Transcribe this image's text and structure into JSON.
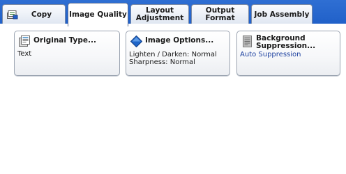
{
  "tabs": [
    {
      "label": "Copy",
      "icon": "copy-icon"
    },
    {
      "label": "Image Quality"
    },
    {
      "label_line1": "Layout",
      "label_line2": "Adjustment"
    },
    {
      "label": "Output Format"
    },
    {
      "label": "Job Assembly"
    }
  ],
  "features": {
    "original_type": {
      "title": "Original Type...",
      "value": "Text",
      "icon": "original-type-icon"
    },
    "image_options": {
      "title": "Image Options...",
      "value_line1": "Lighten / Darken: Normal",
      "value_line2": "Sharpness: Normal",
      "icon": "diamond-icon"
    },
    "background_suppression": {
      "title_line1": "Background",
      "title_line2": "Suppression...",
      "value": "Auto Suppression",
      "icon": "background-suppression-icon"
    }
  },
  "colors": {
    "tabbar": "#2f6fd3",
    "value_blue": "#1b3f9e",
    "diamond": "#1e64c8"
  }
}
